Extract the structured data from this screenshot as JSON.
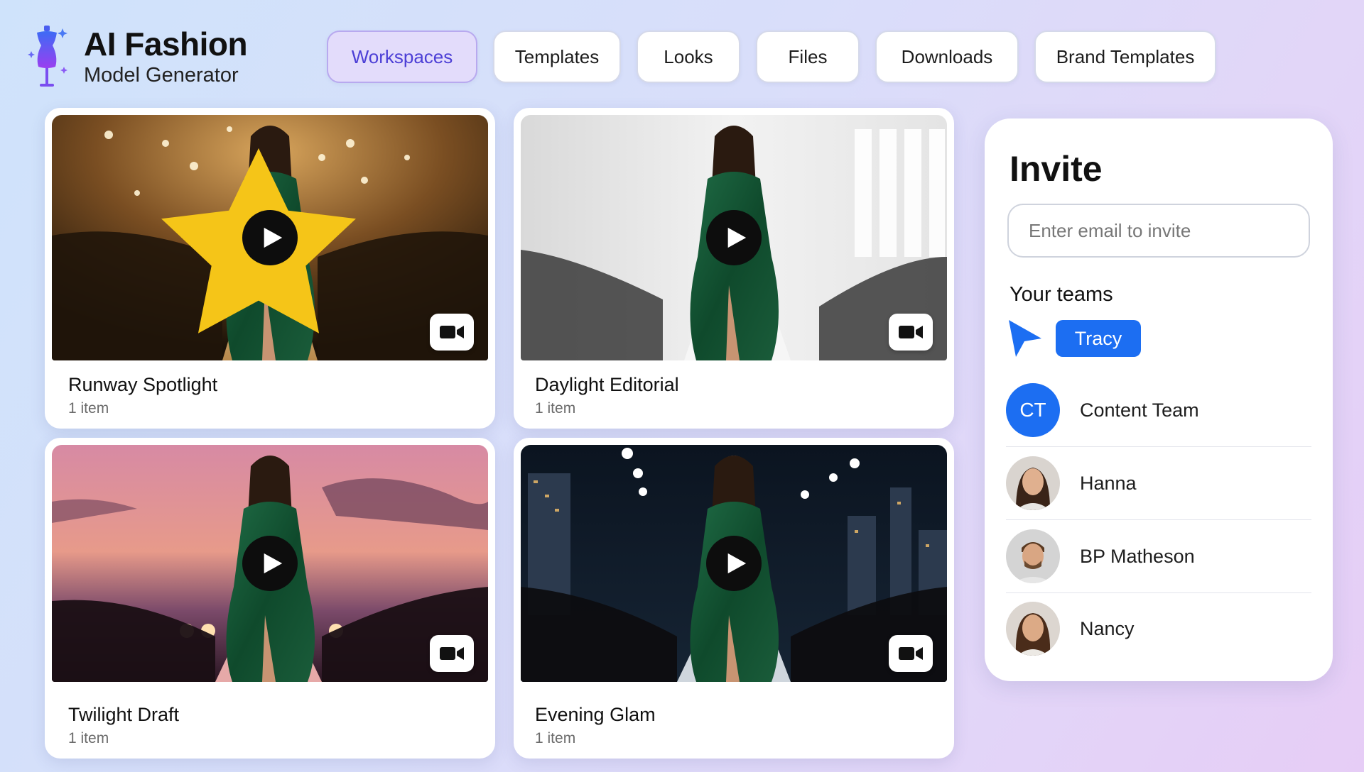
{
  "app": {
    "title": "AI Fashion",
    "subtitle": "Model Generator"
  },
  "nav": {
    "tabs": [
      {
        "label": "Workspaces",
        "active": true
      },
      {
        "label": "Templates",
        "active": false
      },
      {
        "label": "Looks",
        "active": false
      },
      {
        "label": "Files",
        "active": false
      },
      {
        "label": "Downloads",
        "active": false
      },
      {
        "label": "Brand Templates",
        "active": false
      }
    ]
  },
  "workspaces": [
    {
      "title": "Runway Spotlight",
      "meta": "1 item",
      "starred": true,
      "media": "video"
    },
    {
      "title": "Daylight Editorial",
      "meta": "1 item",
      "starred": false,
      "media": "video"
    },
    {
      "title": "Twilight Draft",
      "meta": "1 item",
      "starred": false,
      "media": "video"
    },
    {
      "title": "Evening Glam",
      "meta": "1 item",
      "starred": false,
      "media": "video"
    }
  ],
  "invite": {
    "title": "Invite",
    "email_placeholder": "Enter email to invite",
    "email_value": "",
    "teams_label": "Your teams",
    "current_user": "Tracy",
    "members": [
      {
        "name": "Content Team",
        "initials": "CT"
      },
      {
        "name": "Hanna"
      },
      {
        "name": "BP Matheson"
      },
      {
        "name": "Nancy"
      }
    ]
  },
  "colors": {
    "accent": "#4c3fd6",
    "active_tab_bg": "#e3dcfb",
    "primary_blue": "#1c6ef2",
    "star": "#f5c518"
  },
  "icons": [
    "dress-form-logo-icon",
    "play-icon",
    "video-camera-icon",
    "star-icon",
    "cursor-arrow-icon"
  ]
}
